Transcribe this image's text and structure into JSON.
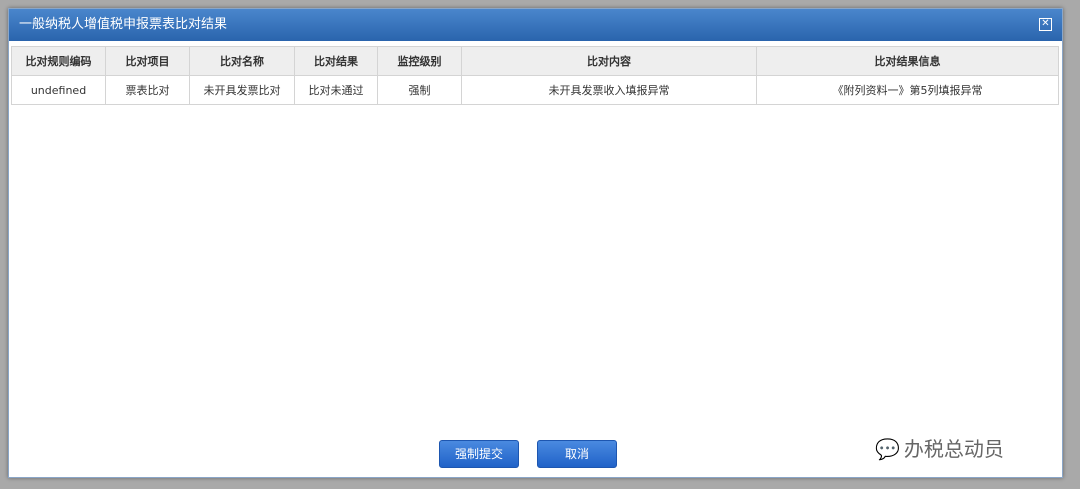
{
  "dialog": {
    "title": "一般纳税人增值税申报票表比对结果",
    "close_icon": "close-icon"
  },
  "table": {
    "headers": [
      "比对规则编码",
      "比对项目",
      "比对名称",
      "比对结果",
      "监控级别",
      "比对内容",
      "比对结果信息"
    ],
    "rows": [
      [
        "undefined",
        "票表比对",
        "未开具发票比对",
        "比对未通过",
        "强制",
        "未开具发票收入填报异常",
        "《附列资料一》第5列填报异常"
      ]
    ]
  },
  "buttons": {
    "submit": "强制提交",
    "cancel": "取消"
  },
  "watermark": "办税总动员"
}
